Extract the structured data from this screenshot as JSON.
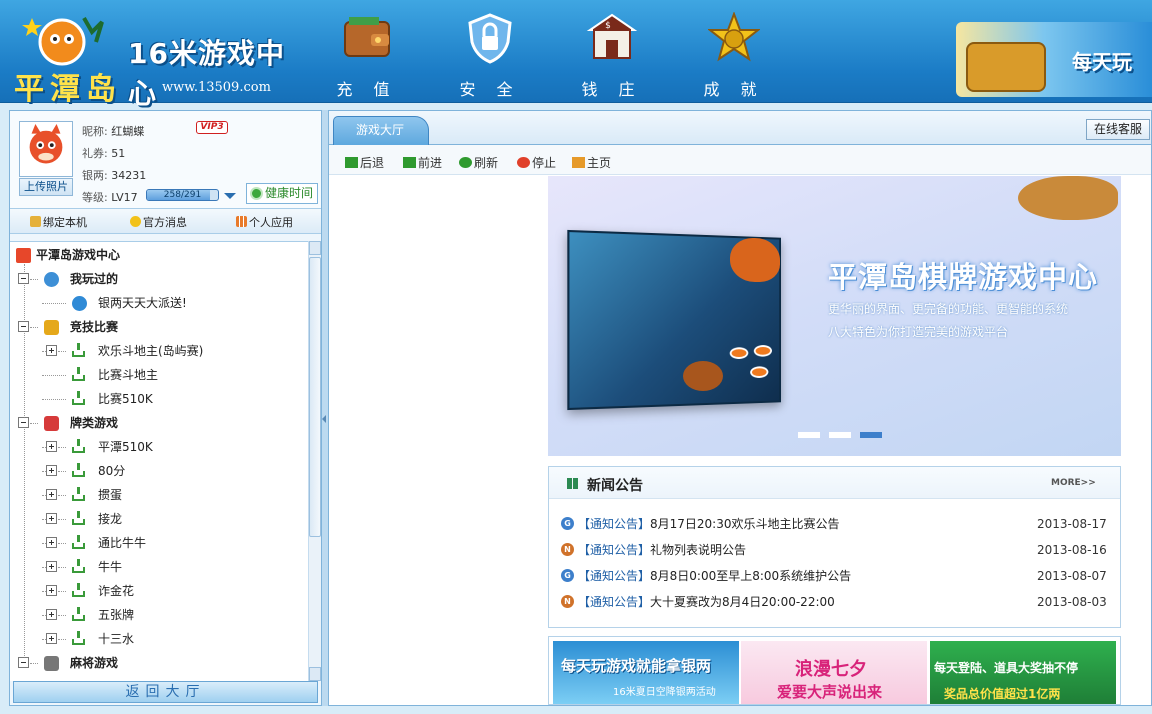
{
  "header": {
    "logo_title": "16米游戏中心",
    "logo_brand": "平潭岛",
    "logo_url": "www.13509.com",
    "nav": [
      {
        "label": "充 值",
        "icon": "wallet-icon"
      },
      {
        "label": "安 全",
        "icon": "shield-lock-icon"
      },
      {
        "label": "钱 庄",
        "icon": "bank-icon"
      },
      {
        "label": "成 就",
        "icon": "star-medal-icon"
      }
    ],
    "ad_text": "每天玩"
  },
  "profile": {
    "nickname_label": "昵称:",
    "nickname": "红蝴蝶",
    "vip_badge": "VIP3",
    "coupon_label": "礼券:",
    "coupon": "51",
    "silver_label": "银两:",
    "silver": "34231",
    "level_label": "等级:",
    "level": "LV17",
    "exp_text": "258/291",
    "exp_fraction": 0.887,
    "upload_label": "上传照片",
    "health_label": "健康时间"
  },
  "quick_links": [
    "绑定本机",
    "官方消息",
    "个人应用"
  ],
  "tree": {
    "root": "平潭岛游戏中心",
    "nodes": [
      {
        "label": "我玩过的",
        "level": 1,
        "expander": "minus",
        "icon": "person-icon"
      },
      {
        "label": "银两天天大派送!",
        "level": 2,
        "expander": "none",
        "icon": "ie-icon"
      },
      {
        "label": "竞技比赛",
        "level": 1,
        "expander": "minus",
        "icon": "trophy-icon"
      },
      {
        "label": "欢乐斗地主(岛屿赛)",
        "level": 2,
        "expander": "plus",
        "icon": "download-icon"
      },
      {
        "label": "比赛斗地主",
        "level": 2,
        "expander": "none",
        "icon": "download-icon"
      },
      {
        "label": "比赛510K",
        "level": 2,
        "expander": "none",
        "icon": "download-icon"
      },
      {
        "label": "牌类游戏",
        "level": 1,
        "expander": "minus",
        "icon": "playing-card-icon"
      },
      {
        "label": "平潭510K",
        "level": 2,
        "expander": "plus",
        "icon": "download-icon"
      },
      {
        "label": "80分",
        "level": 2,
        "expander": "plus",
        "icon": "download-icon"
      },
      {
        "label": "掼蛋",
        "level": 2,
        "expander": "plus",
        "icon": "download-icon"
      },
      {
        "label": "接龙",
        "level": 2,
        "expander": "plus",
        "icon": "download-icon"
      },
      {
        "label": "通比牛牛",
        "level": 2,
        "expander": "plus",
        "icon": "download-icon"
      },
      {
        "label": "牛牛",
        "level": 2,
        "expander": "plus",
        "icon": "download-icon"
      },
      {
        "label": "诈金花",
        "level": 2,
        "expander": "plus",
        "icon": "download-icon"
      },
      {
        "label": "五张牌",
        "level": 2,
        "expander": "plus",
        "icon": "download-icon"
      },
      {
        "label": "十三水",
        "level": 2,
        "expander": "plus",
        "icon": "download-icon"
      },
      {
        "label": "麻将游戏",
        "level": 1,
        "expander": "minus",
        "icon": "mahjong-tile-icon"
      }
    ]
  },
  "back_hall": "返回大厅",
  "tabs": {
    "active": "游戏大厅",
    "service_button": "在线客服"
  },
  "toolbar": [
    "后退",
    "前进",
    "刷新",
    "停止",
    "主页"
  ],
  "banner": {
    "title": "平潭岛棋牌游戏中心",
    "line1": "更华丽的界面、更完备的功能、更智能的系统",
    "line2": "八大特色为你打造完美的游戏平台",
    "slides": 3,
    "active_slide": 3
  },
  "news": {
    "title": "新闻公告",
    "more": "MORE>>",
    "items": [
      {
        "icon": "G",
        "tag": "【通知公告】",
        "title": "8月17日20:30欢乐斗地主比赛公告",
        "date": "2013-08-17",
        "icon_color": "#3d7fcb"
      },
      {
        "icon": "N",
        "tag": "【通知公告】",
        "title": "礼物列表说明公告",
        "date": "2013-08-16",
        "icon_color": "#d0722a"
      },
      {
        "icon": "G",
        "tag": "【通知公告】",
        "title": "8月8日0:00至早上8:00系统维护公告",
        "date": "2013-08-07",
        "icon_color": "#3d7fcb"
      },
      {
        "icon": "N",
        "tag": "【通知公告】",
        "title": "大十夏赛改为8月4日20:00-22:00",
        "date": "2013-08-03",
        "icon_color": "#d0722a"
      }
    ]
  },
  "promos": [
    {
      "a": "每天玩游戏就能拿银两",
      "b": "16米夏日空降银两活动"
    },
    {
      "a": "浪漫七夕",
      "b": "爱要大声说出来"
    },
    {
      "a": "每天登陆、道具大奖抽不停",
      "b": "奖品总价值超过1亿两"
    }
  ]
}
